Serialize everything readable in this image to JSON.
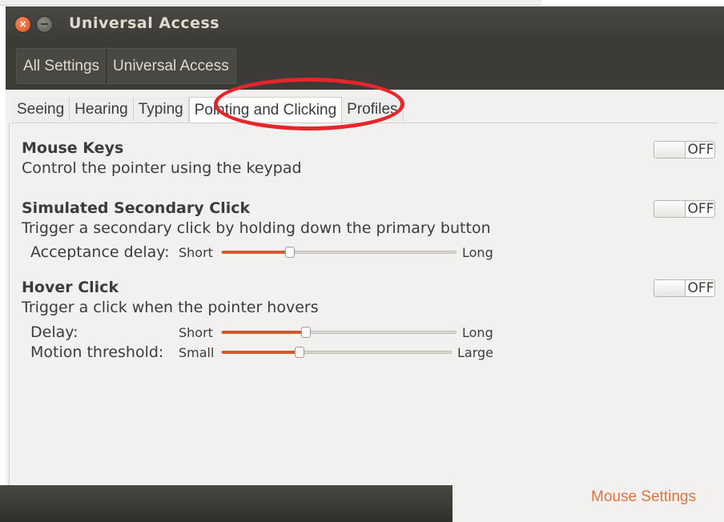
{
  "window": {
    "title": "Universal Access"
  },
  "breadcrumbs": [
    "All Settings",
    "Universal Access"
  ],
  "tabs": [
    "Seeing",
    "Hearing",
    "Typing",
    "Pointing and Clicking",
    "Profiles"
  ],
  "active_tab": "Pointing and Clicking",
  "sections": {
    "mouse_keys": {
      "title": "Mouse Keys",
      "desc": "Control the pointer using the keypad",
      "toggle": "OFF"
    },
    "secondary_click": {
      "title": "Simulated Secondary Click",
      "desc": "Trigger a secondary click by holding down the primary button",
      "toggle": "OFF",
      "acceptance_delay": {
        "label": "Acceptance delay:",
        "min_label": "Short",
        "max_label": "Long",
        "value": 0.29
      }
    },
    "hover_click": {
      "title": "Hover Click",
      "desc": "Trigger a click when the pointer hovers",
      "toggle": "OFF",
      "delay": {
        "label": "Delay:",
        "min_label": "Short",
        "max_label": "Long",
        "value": 0.36
      },
      "motion_threshold": {
        "label": "Motion threshold:",
        "min_label": "Small",
        "max_label": "Large",
        "value": 0.34
      }
    }
  },
  "footer": {
    "mouse_settings_link": "Mouse Settings"
  },
  "colors": {
    "accent": "#d05a2c",
    "link": "#e0743f",
    "annotation": "#e8252a"
  }
}
